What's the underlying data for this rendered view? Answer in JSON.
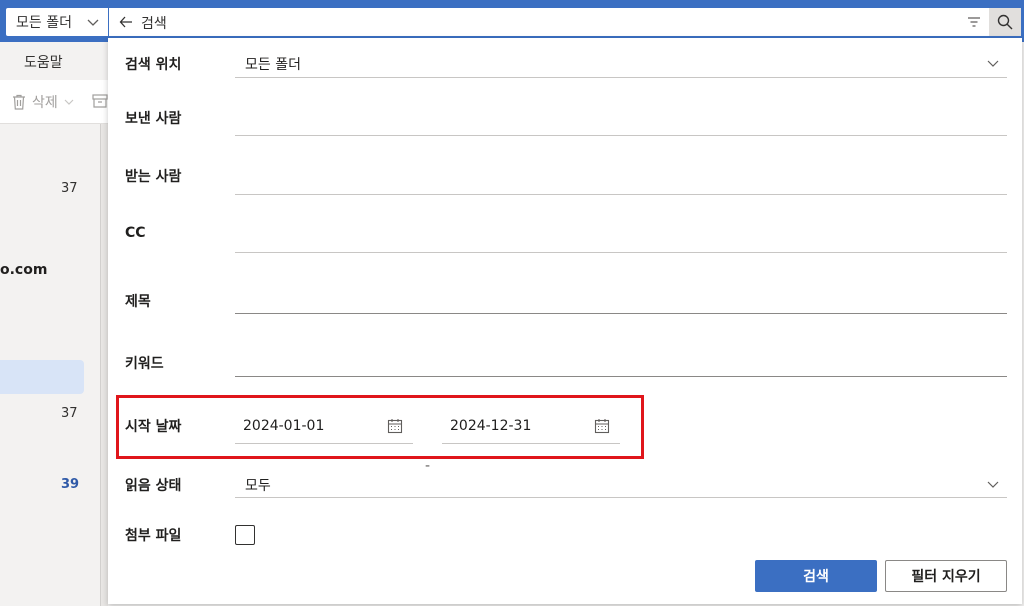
{
  "topbar": {
    "folder_select": "모든 폴더",
    "search_query": "검색"
  },
  "background": {
    "ribbon_tab": "도움말",
    "delete_label": "삭제",
    "counts": [
      "37",
      "37",
      "39"
    ],
    "email_fragment": "o.com"
  },
  "search_panel": {
    "location": {
      "label": "검색 위치",
      "value": "모든 폴더"
    },
    "from": {
      "label": "보낸 사람"
    },
    "to": {
      "label": "받는 사람"
    },
    "cc": {
      "label": "CC"
    },
    "subject": {
      "label": "제목"
    },
    "keywords": {
      "label": "키워드"
    },
    "date": {
      "label": "시작 날짜",
      "start": "2024-01-01",
      "separator": "-",
      "end": "2024-12-31"
    },
    "read_status": {
      "label": "읽음 상태",
      "value": "모두"
    },
    "attachments": {
      "label": "첨부 파일"
    },
    "search_button": "검색",
    "clear_button": "필터 지우기"
  },
  "colors": {
    "accent": "#3b6fc2",
    "highlight": "#e0161b"
  }
}
